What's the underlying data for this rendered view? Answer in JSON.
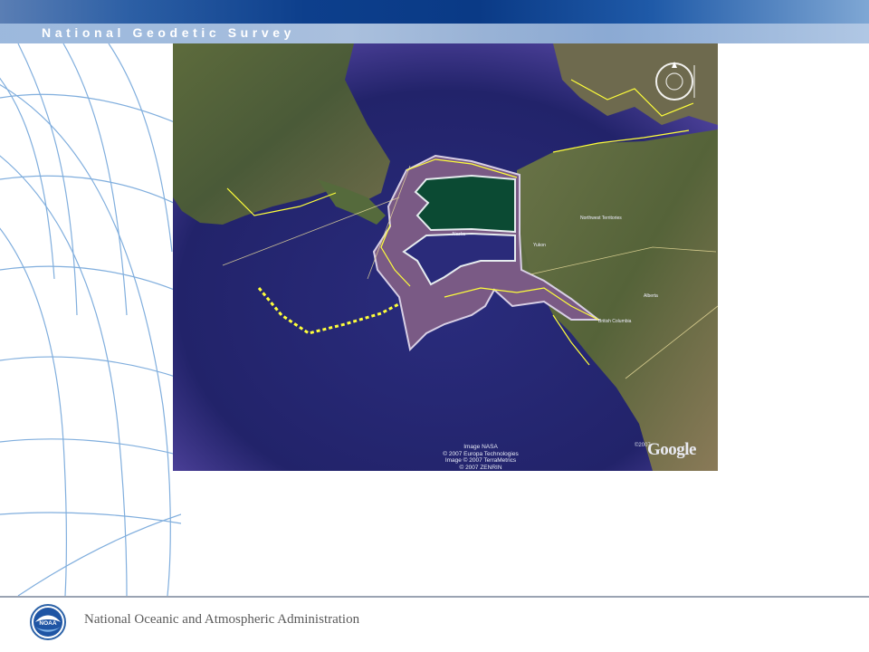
{
  "header": {
    "title": "National Geodetic Survey"
  },
  "map": {
    "credits": [
      "Image NASA",
      "© 2007 Europa Technologies",
      "Image © 2007 TerraMetrics",
      "© 2007 ZENRIN"
    ],
    "brand": "Google",
    "year_label": "©2007",
    "region_labels": [
      "Northwest Territories",
      "Yukon",
      "Alberta",
      "British Columbia",
      "Alaska"
    ],
    "colors": {
      "ocean": "#23246e",
      "zone_north": "#0b4a33",
      "zone_central": "#2a2b7a",
      "zone_buffer": "#7a5a85",
      "coastline": "#ffff3a"
    }
  },
  "footer": {
    "agency": "National Oceanic and Atmospheric Administration",
    "logo_text": "NOAA"
  }
}
